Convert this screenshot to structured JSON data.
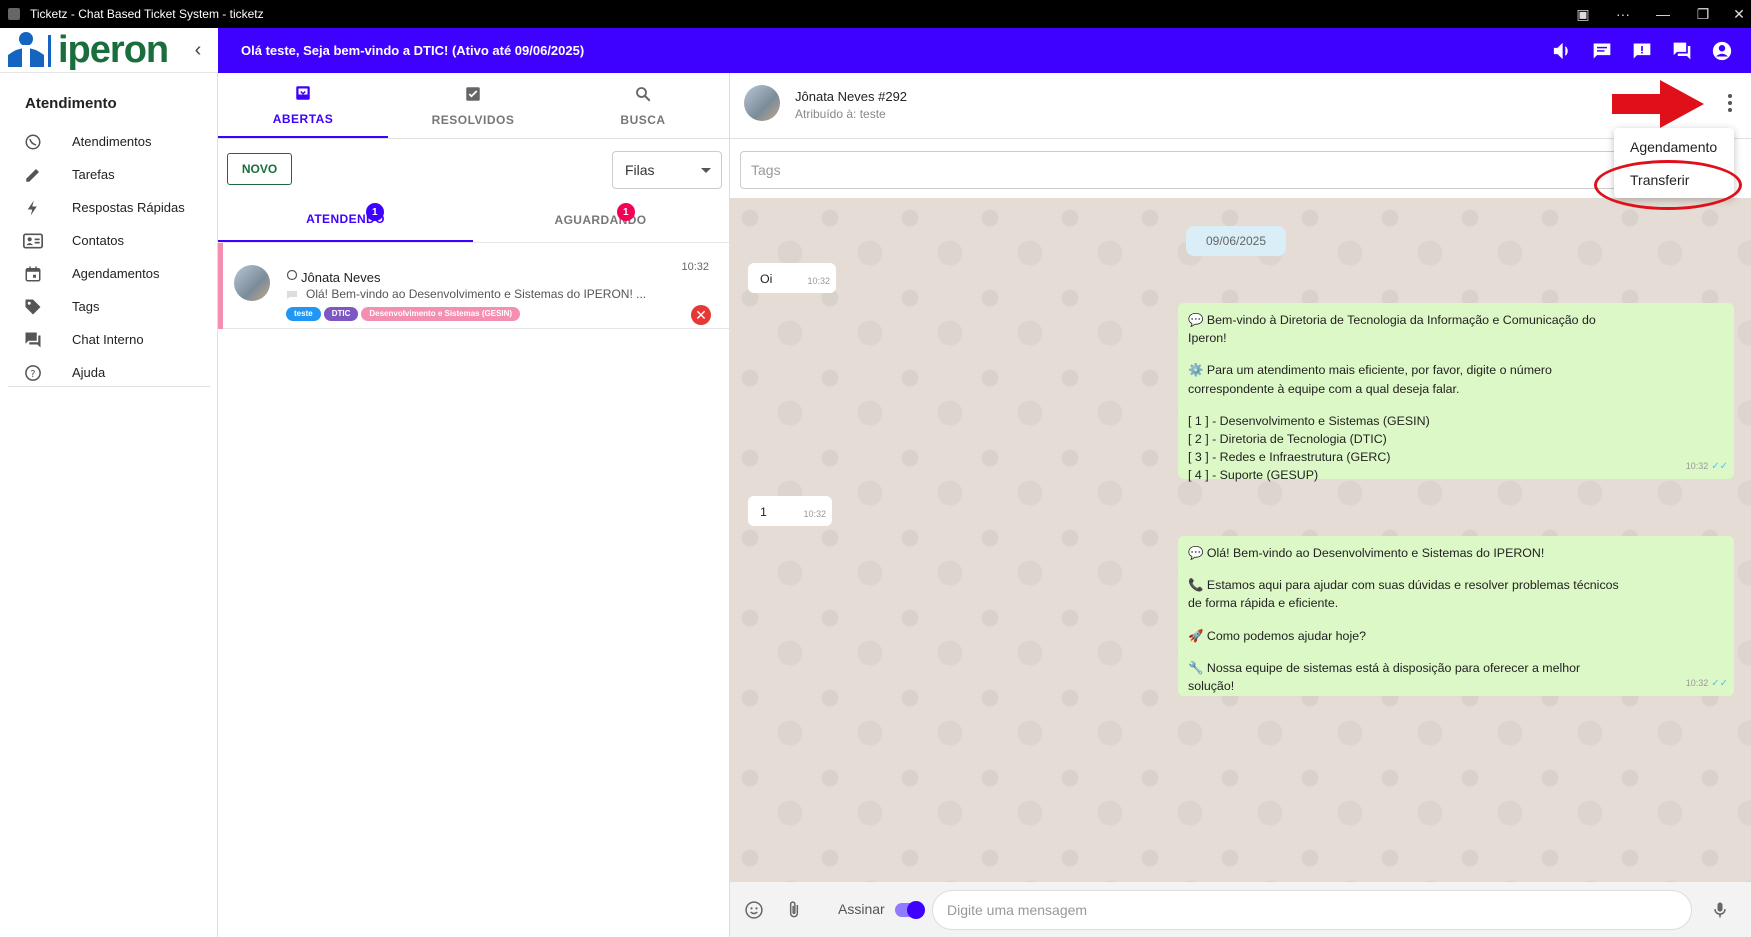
{
  "window": {
    "title": "Ticketz - Chat Based Ticket System - ticketz"
  },
  "brand": {
    "logo_text": "iperon"
  },
  "topbar": {
    "welcome": "Olá teste, Seja bem-vindo a DTIC! (Ativo até 09/06/2025)"
  },
  "sidebar": {
    "section": "Atendimento",
    "items": [
      {
        "label": "Atendimentos",
        "icon": "whatsapp-icon"
      },
      {
        "label": "Tarefas",
        "icon": "pencil-icon"
      },
      {
        "label": "Respostas Rápidas",
        "icon": "bolt-icon"
      },
      {
        "label": "Contatos",
        "icon": "contact-card-icon"
      },
      {
        "label": "Agendamentos",
        "icon": "calendar-icon"
      },
      {
        "label": "Tags",
        "icon": "tag-icon"
      },
      {
        "label": "Chat Interno",
        "icon": "forum-icon"
      },
      {
        "label": "Ajuda",
        "icon": "help-icon"
      }
    ]
  },
  "tickets": {
    "tabs": [
      {
        "label": "ABERTAS",
        "icon": "inbox-icon"
      },
      {
        "label": "RESOLVIDOS",
        "icon": "check-box-icon"
      },
      {
        "label": "BUSCA",
        "icon": "search-icon"
      }
    ],
    "new_button": "NOVO",
    "queue_select": "Filas",
    "subtabs": [
      {
        "label": "ATENDENDO",
        "badge": "1"
      },
      {
        "label": "AGUARDANDO",
        "badge": "1"
      }
    ],
    "list": [
      {
        "name": "Jônata Neves",
        "time": "10:32",
        "preview": "Olá! Bem-vindo ao Desenvolvimento e Sistemas do IPERON! ...",
        "tags": [
          {
            "label": "teste",
            "color": "#2196f3"
          },
          {
            "label": "DTIC",
            "color": "#7e57c2"
          },
          {
            "label": "Desenvolvimento e Sistemas (GESIN)",
            "color": "#f48fb1"
          }
        ]
      }
    ]
  },
  "chat": {
    "contact": "Jônata Neves #292",
    "assigned": "Atribuído à: teste",
    "tags_placeholder": "Tags",
    "date": "09/06/2025",
    "messages": [
      {
        "dir": "in",
        "time": "10:32",
        "lines": [
          "Oi"
        ]
      },
      {
        "dir": "out",
        "time": "10:32",
        "lines": [
          "💬 Bem-vindo à Diretoria de Tecnologia da Informação e Comunicação do",
          "Iperon!",
          "",
          "⚙️ Para um atendimento mais eficiente, por favor, digite o número",
          "correspondente à equipe com a qual deseja falar.",
          "",
          "[ 1 ] - Desenvolvimento e Sistemas (GESIN)",
          "[ 2 ] - Diretoria de Tecnologia (DTIC)",
          "[ 3 ] - Redes e Infraestrutura (GERC)",
          "[ 4 ] - Suporte (GESUP)"
        ]
      },
      {
        "dir": "in",
        "time": "10:32",
        "lines": [
          "1"
        ]
      },
      {
        "dir": "out",
        "time": "10:32",
        "lines": [
          "💬 Olá! Bem-vindo ao Desenvolvimento e Sistemas do IPERON!",
          "",
          "📞 Estamos aqui para ajudar com suas dúvidas e resolver problemas técnicos",
          "de forma rápida e eficiente.",
          "",
          "🚀 Como podemos ajudar hoje?",
          "",
          "🔧 Nossa equipe de sistemas está à disposição para oferecer a melhor",
          "solução!"
        ]
      }
    ],
    "menu": [
      "Agendamento",
      "Transferir"
    ],
    "composer": {
      "sign_label": "Assinar",
      "placeholder": "Digite uma mensagem"
    }
  },
  "colors": {
    "primary": "#3e00ff",
    "brand_green": "#1a6e3c",
    "annotation_red": "#e0101a"
  }
}
